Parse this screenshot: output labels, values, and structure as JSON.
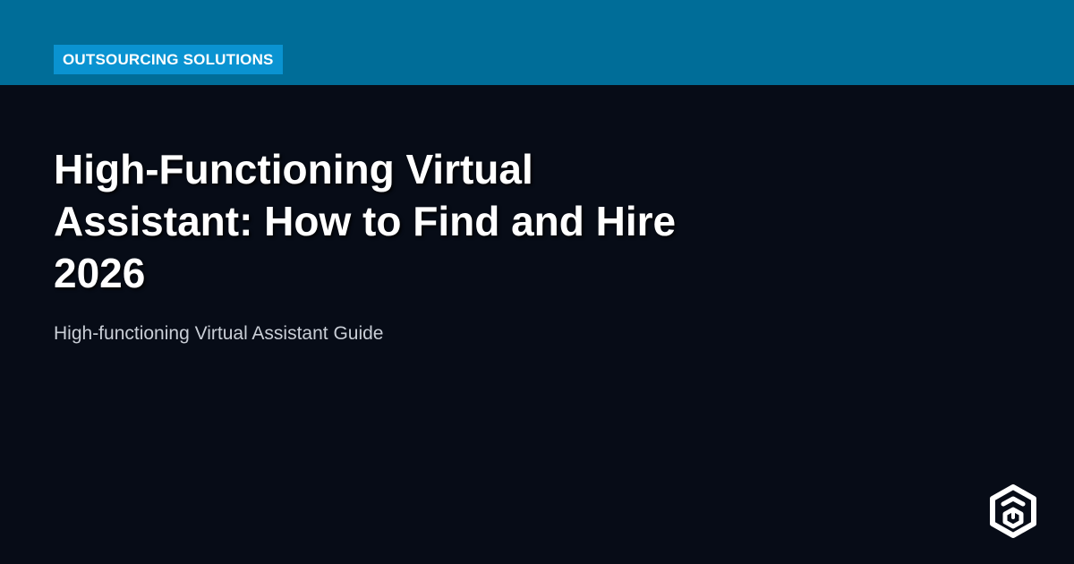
{
  "category": "OUTSOURCING SOLUTIONS",
  "title": "High-Functioning Virtual Assistant: How to Find and Hire 2026",
  "subtitle": "High-functioning Virtual Assistant Guide",
  "logo": {
    "icon": "hexagon-cube-logo-icon"
  },
  "colors": {
    "background": "#070c17",
    "top_band": "#006d98",
    "badge": "#0a93d1",
    "title_text": "#ffffff",
    "subtitle_text": "#c9ced6"
  }
}
